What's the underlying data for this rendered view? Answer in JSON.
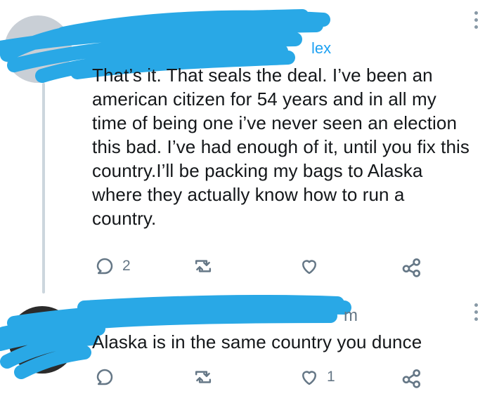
{
  "tweet1": {
    "replying_to_visible": "lex",
    "text": "That’s it. That seals the deal. I’ve been an american citizen for 54 years and in all my time of being one i’ve never seen an election this bad. I’ve had enough of it, until you fix this country.I’ll be packing my bags to Alaska where they actually know how to run a country.",
    "actions": {
      "reply_count": "2",
      "retweet_count": "",
      "like_count": ""
    }
  },
  "tweet2": {
    "handle_visible": "m",
    "text": "Alaska is in the same country you dunce",
    "actions": {
      "reply_count": "",
      "retweet_count": "",
      "like_count": "1"
    }
  },
  "icons": [
    "reply-icon",
    "retweet-icon",
    "like-icon",
    "share-icon",
    "more-icon"
  ],
  "colors": {
    "redaction": "#29a8e6",
    "icon": "#657786",
    "thread": "#ccd6dd",
    "link": "#1da1f2"
  }
}
